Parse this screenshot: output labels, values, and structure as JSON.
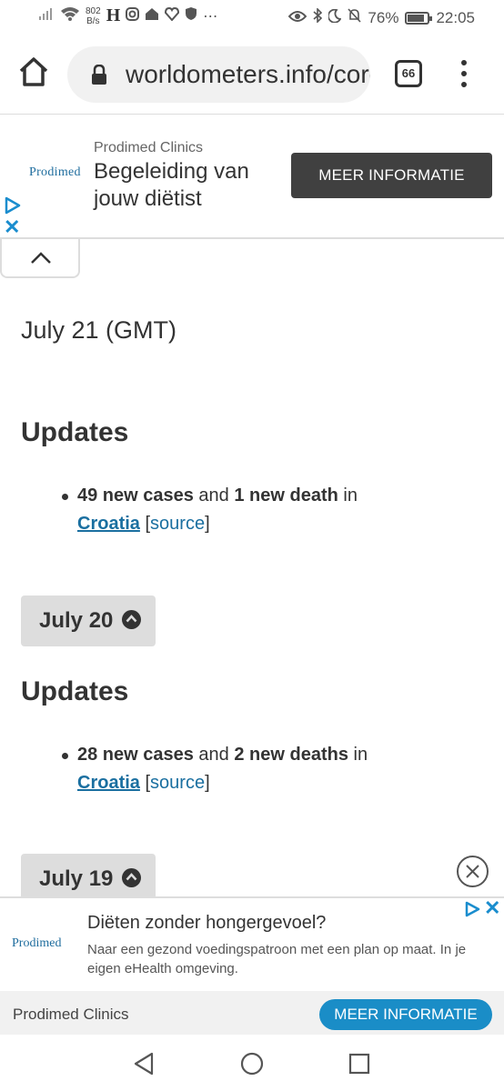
{
  "status_bar": {
    "net_speed_value": "802",
    "net_speed_unit": "B/s",
    "battery_percent": "76%",
    "battery_level": 0.76,
    "time": "22:05"
  },
  "browser": {
    "url": "worldometers.info/coronavirus/country/croatia",
    "tab_count": "66"
  },
  "ad_top": {
    "logo": "Prodimed",
    "advertiser": "Prodimed Clinics",
    "headline": "Begeleiding van jouw diëtist",
    "cta": "MEER INFORMATIE"
  },
  "content": {
    "date_heading": "July 21 (GMT)",
    "sections": [
      {
        "updates_heading": "Updates",
        "cases": "49 new cases",
        "and": " and ",
        "deaths": "1 new death",
        "in": " in",
        "country": "Croatia",
        "source": "source"
      },
      {
        "date_button": "July 20",
        "updates_heading": "Updates",
        "cases": "28 new cases",
        "and": " and ",
        "deaths": "2 new deaths",
        "in": " in",
        "country": "Croatia",
        "source": "source"
      },
      {
        "date_button": "July 19"
      }
    ]
  },
  "ad_bottom": {
    "logo": "Prodimed",
    "headline": "Diëten zonder hongergevoel?",
    "description": "Naar een gezond voedingspatroon met een plan op maat. In je eigen eHealth omgeving.",
    "advertiser": "Prodimed Clinics",
    "cta": "MEER INFORMATIE"
  },
  "icons": {
    "home": "home-icon",
    "lock": "lock-icon",
    "tabs": "tabs-icon",
    "menu": "more-vert-icon",
    "chevron_up": "chevron-up-icon",
    "close": "close-icon",
    "nav_back": "back-triangle-icon",
    "nav_home": "home-circle-icon",
    "nav_recents": "recents-square-icon"
  },
  "colors": {
    "link": "#1a6fa0",
    "ad_cta_dark": "#404040",
    "ad_cta_blue": "#1a8dc7"
  }
}
